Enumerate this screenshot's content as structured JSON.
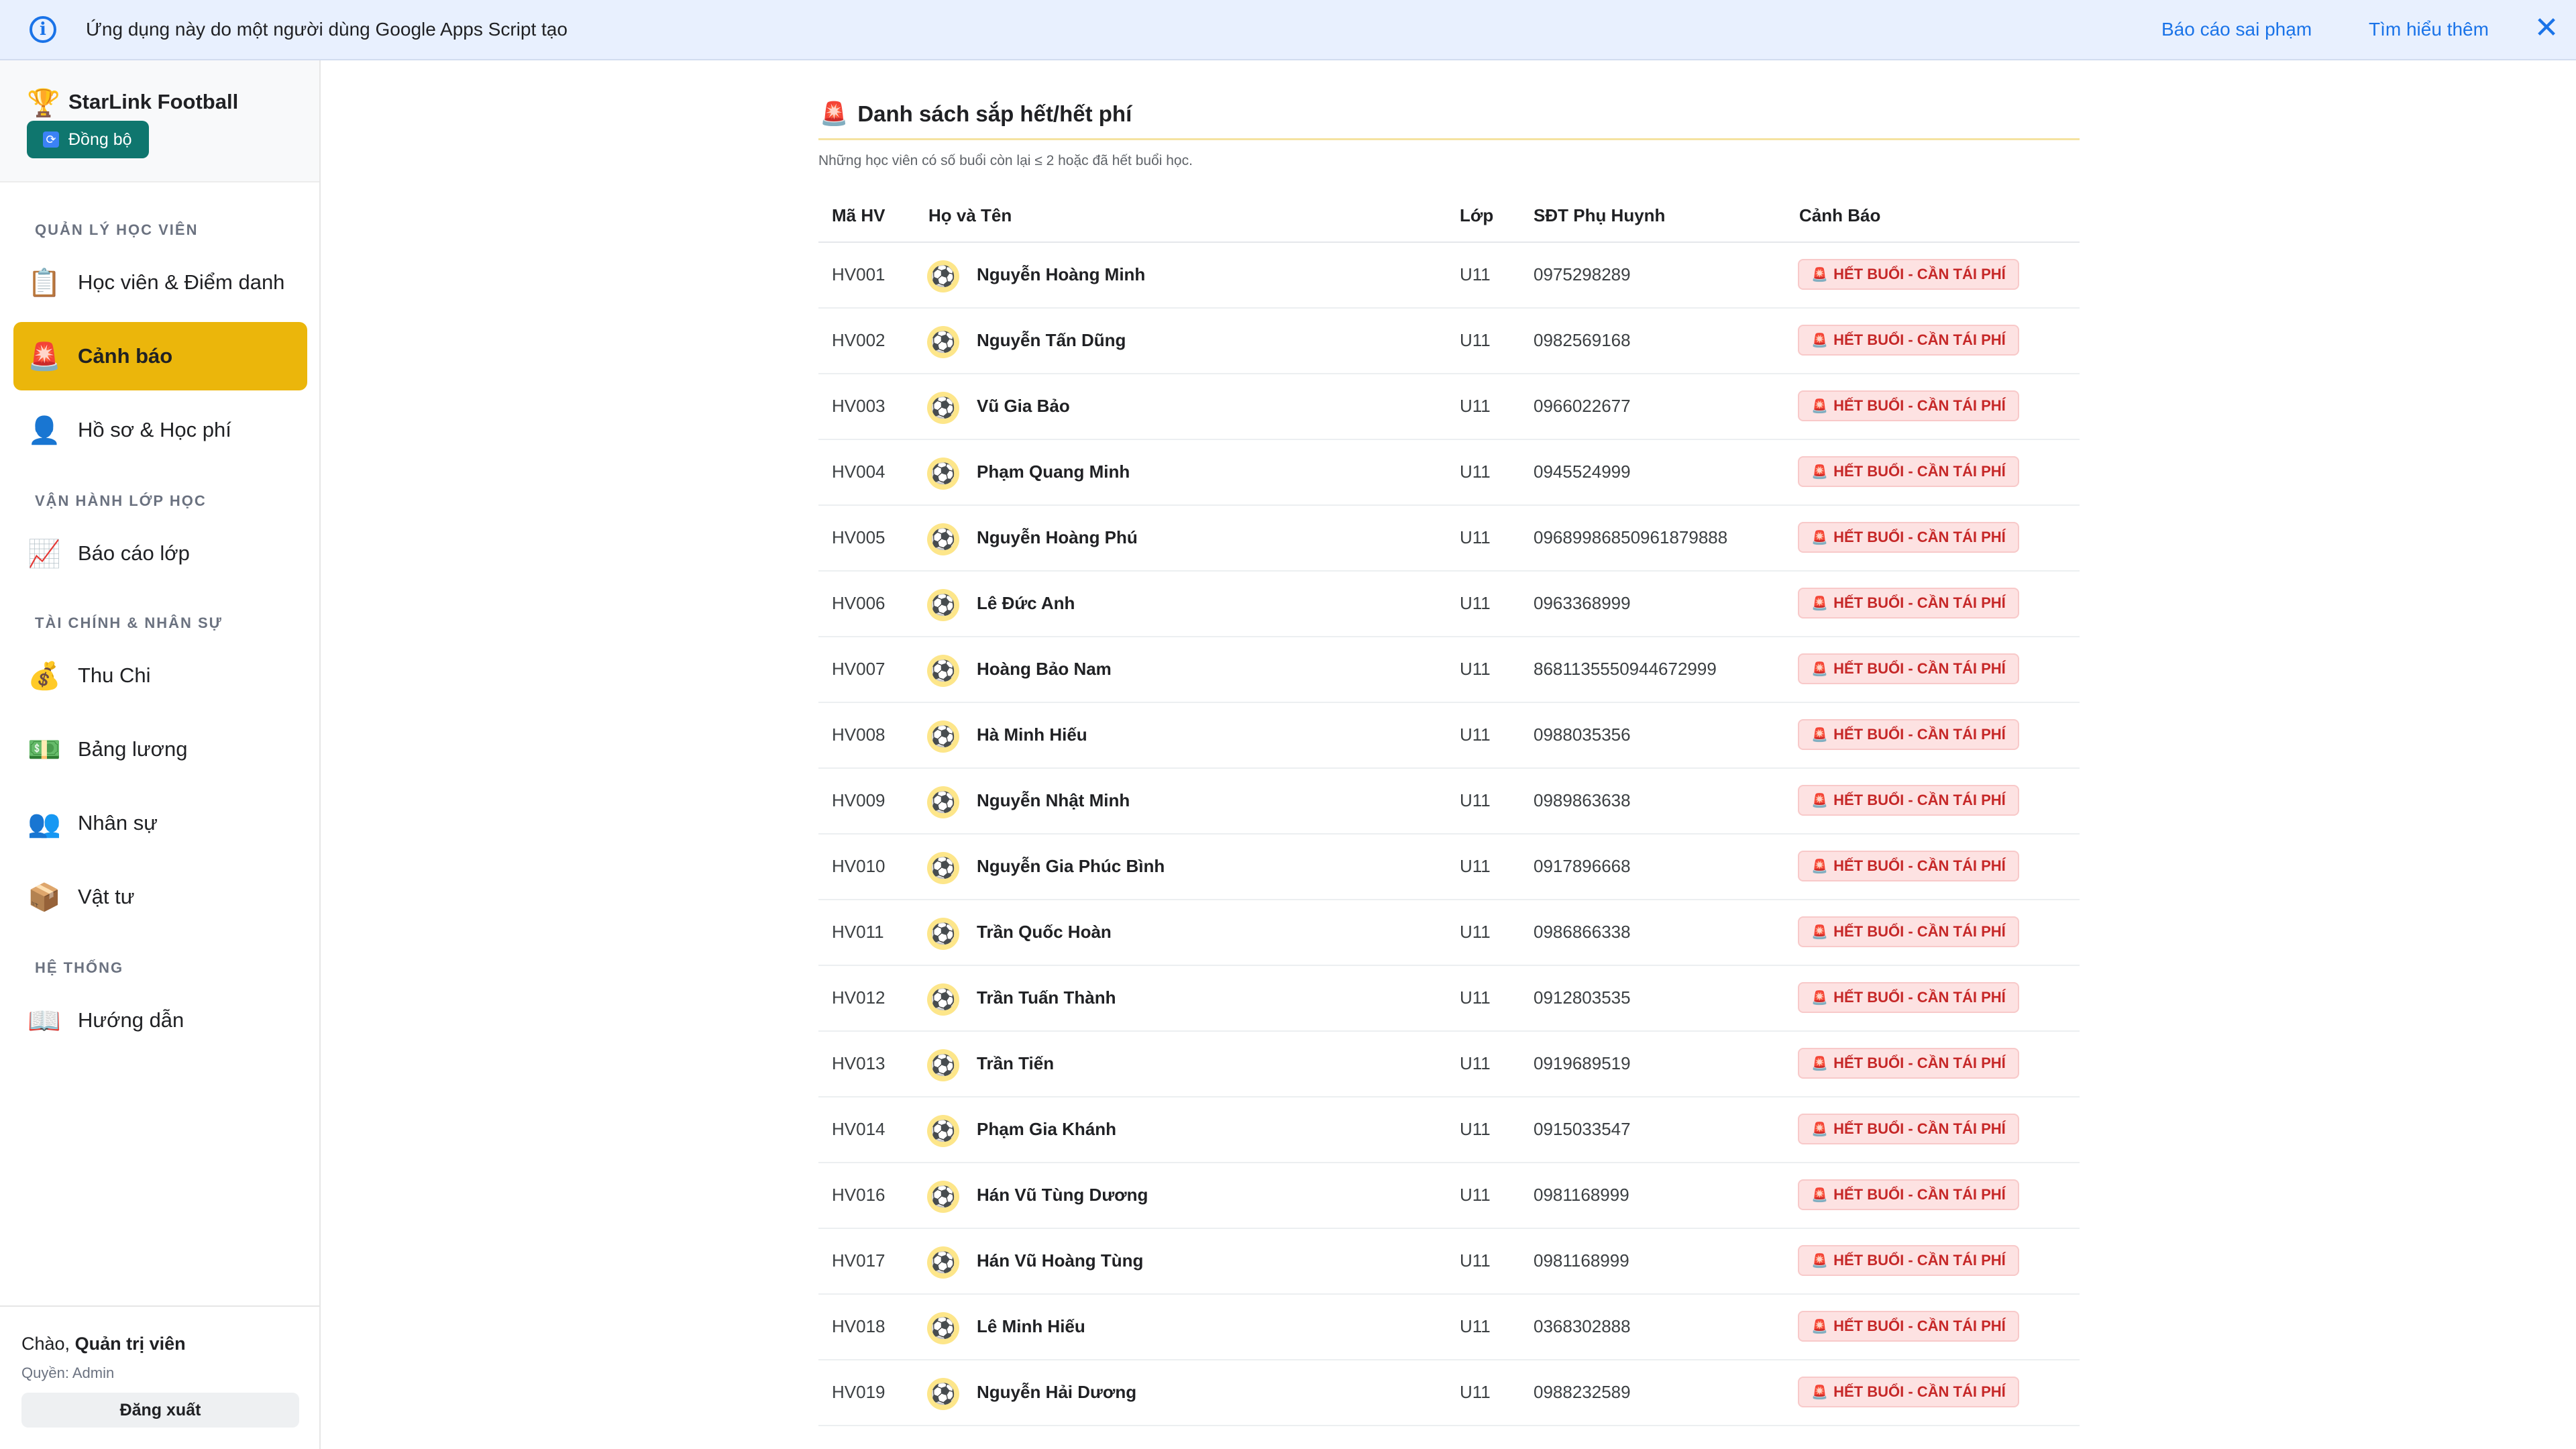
{
  "banner": {
    "text": "Ứng dụng này do một người dùng Google Apps Script tạo",
    "report_link": "Báo cáo sai phạm",
    "learn_link": "Tìm hiểu thêm",
    "info_icon": "info-icon",
    "close_icon": "close-icon"
  },
  "sidebar": {
    "brand": "StarLink Football",
    "brand_icon": "🏆",
    "sync_label": "Đồng bộ",
    "sections": [
      "QUẢN LÝ HỌC VIÊN",
      "VẬN HÀNH LỚP HỌC",
      "TÀI CHÍNH & NHÂN SỰ",
      "HỆ THỐNG"
    ],
    "items": [
      {
        "label": "Học viên & Điểm danh",
        "icon": "📋"
      },
      {
        "label": "Cảnh báo",
        "icon": "🚨"
      },
      {
        "label": "Hồ sơ & Học phí",
        "icon": "👤"
      },
      {
        "label": "Báo cáo lớp",
        "icon": "📈"
      },
      {
        "label": "Thu Chi",
        "icon": "💰"
      },
      {
        "label": "Bảng lương",
        "icon": "💵"
      },
      {
        "label": "Nhân sự",
        "icon": "👥"
      },
      {
        "label": "Vật tư",
        "icon": "📦"
      },
      {
        "label": "Hướng dẫn",
        "icon": "📖"
      }
    ],
    "user": {
      "greeting": "Chào,",
      "name": "Quản trị viên",
      "role": "Quyền: Admin",
      "logout": "Đăng xuất"
    }
  },
  "main": {
    "title_icon": "🚨",
    "title": "Danh sách sắp hết/hết phí",
    "subtitle": "Những học viên có số buổi còn lại ≤ 2 hoặc đã hết buổi học.",
    "columns": [
      "Mã HV",
      "Họ và Tên",
      "Lớp",
      "SĐT Phụ Huynh",
      "Cảnh Báo"
    ],
    "avatar_icon": "⚽",
    "badge_icon": "🚨",
    "rows": [
      {
        "id": "HV001",
        "name": "Nguyễn Hoàng Minh",
        "class": "U11",
        "phone": "0975298289",
        "warning": "HẾT BUỔI - CẦN TÁI PHÍ"
      },
      {
        "id": "HV002",
        "name": "Nguyễn Tấn Dũng",
        "class": "U11",
        "phone": "0982569168",
        "warning": "HẾT BUỔI - CẦN TÁI PHÍ"
      },
      {
        "id": "HV003",
        "name": "Vũ Gia Bảo",
        "class": "U11",
        "phone": "0966022677",
        "warning": "HẾT BUỔI - CẦN TÁI PHÍ"
      },
      {
        "id": "HV004",
        "name": "Phạm Quang Minh",
        "class": "U11",
        "phone": "0945524999",
        "warning": "HẾT BUỔI - CẦN TÁI PHÍ"
      },
      {
        "id": "HV005",
        "name": "Nguyễn Hoàng Phú",
        "class": "U11",
        "phone": "0968998685096187988​8",
        "warning": "HẾT BUỔI - CẦN TÁI PHÍ"
      },
      {
        "id": "HV006",
        "name": "Lê Đức Anh",
        "class": "U11",
        "phone": "0963368999",
        "warning": "HẾT BUỔI - CẦN TÁI PHÍ"
      },
      {
        "id": "HV007",
        "name": "Hoàng Bảo Nam",
        "class": "U11",
        "phone": "8681135550944672999",
        "warning": "HẾT BUỔI - CẦN TÁI PHÍ"
      },
      {
        "id": "HV008",
        "name": "Hà Minh Hiếu",
        "class": "U11",
        "phone": "0988035356",
        "warning": "HẾT BUỔI - CẦN TÁI PHÍ"
      },
      {
        "id": "HV009",
        "name": "Nguyễn Nhật Minh",
        "class": "U11",
        "phone": "0989863638",
        "warning": "HẾT BUỔI - CẦN TÁI PHÍ"
      },
      {
        "id": "HV010",
        "name": "Nguyễn Gia Phúc Bình",
        "class": "U11",
        "phone": "0917896668",
        "warning": "HẾT BUỔI - CẦN TÁI PHÍ"
      },
      {
        "id": "HV011",
        "name": "Trần Quốc Hoàn",
        "class": "U11",
        "phone": "0986866338",
        "warning": "HẾT BUỔI - CẦN TÁI PHÍ"
      },
      {
        "id": "HV012",
        "name": "Trần Tuấn Thành",
        "class": "U11",
        "phone": "0912803535",
        "warning": "HẾT BUỔI - CẦN TÁI PHÍ"
      },
      {
        "id": "HV013",
        "name": "Trần Tiến",
        "class": "U11",
        "phone": "0919689519",
        "warning": "HẾT BUỔI - CẦN TÁI PHÍ"
      },
      {
        "id": "HV014",
        "name": "Phạm Gia Khánh",
        "class": "U11",
        "phone": "0915033547",
        "warning": "HẾT BUỔI - CẦN TÁI PHÍ"
      },
      {
        "id": "HV016",
        "name": "Hán Vũ Tùng Dương",
        "class": "U11",
        "phone": "0981168999",
        "warning": "HẾT BUỔI - CẦN TÁI PHÍ"
      },
      {
        "id": "HV017",
        "name": "Hán Vũ Hoàng Tùng",
        "class": "U11",
        "phone": "0981168999",
        "warning": "HẾT BUỔI - CẦN TÁI PHÍ"
      },
      {
        "id": "HV018",
        "name": "Lê Minh Hiếu",
        "class": "U11",
        "phone": "0368302888",
        "warning": "HẾT BUỔI - CẦN TÁI PHÍ"
      },
      {
        "id": "HV019",
        "name": "Nguyễn Hải Dương",
        "class": "U11",
        "phone": "0988232589",
        "warning": "HẾT BUỔI - CẦN TÁI PHÍ"
      }
    ]
  }
}
